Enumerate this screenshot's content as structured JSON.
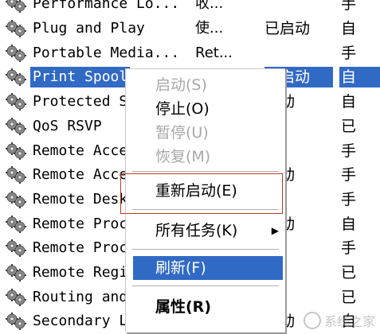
{
  "services": [
    {
      "name": "Performance Lo...",
      "desc": "收...",
      "status": "",
      "startup": "手"
    },
    {
      "name": "Plug and Play",
      "desc": "使...",
      "status": "已启动",
      "startup": "自"
    },
    {
      "name": "Portable Media...",
      "desc": "Ret...",
      "status": "",
      "startup": "手"
    },
    {
      "name": "Print Spool",
      "desc": "",
      "status": "己启动",
      "startup": "自",
      "selected": true
    },
    {
      "name": "Protected S",
      "desc": "",
      "status": "启动",
      "startup": "自"
    },
    {
      "name": "QoS RSVP",
      "desc": "",
      "status": "",
      "startup": "已"
    },
    {
      "name": "Remote Acce",
      "desc": "",
      "status": "",
      "startup": "手"
    },
    {
      "name": "Remote Acce",
      "desc": "",
      "status": "启动",
      "startup": "手"
    },
    {
      "name": "Remote Desk",
      "desc": "",
      "status": "",
      "startup": "手"
    },
    {
      "name": "Remote Proc",
      "desc": "",
      "status": "启动",
      "startup": "自"
    },
    {
      "name": "Remote Proc",
      "desc": "",
      "status": "",
      "startup": "手"
    },
    {
      "name": "Remote Regi",
      "desc": "",
      "status": "",
      "startup": "已"
    },
    {
      "name": "Routing and",
      "desc": "",
      "status": "",
      "startup": "已"
    },
    {
      "name": "Secondary L",
      "desc": "",
      "status": "启动",
      "startup": "自"
    }
  ],
  "menu": {
    "start": "启动(S)",
    "stop": "停止(O)",
    "pause": "暂停(U)",
    "resume": "恢复(M)",
    "restart": "重新启动(E)",
    "all_tasks": "所有任务(K)",
    "refresh": "刷新(F)",
    "properties": "属性(R)"
  },
  "watermark": "系统之家",
  "colors": {
    "selection": "#316ac5",
    "highlight_box": "#c0392b",
    "disabled_text": "#a8a8a8"
  },
  "icons": {
    "service": "gear-icon",
    "submenu": "triangle-right-icon"
  }
}
